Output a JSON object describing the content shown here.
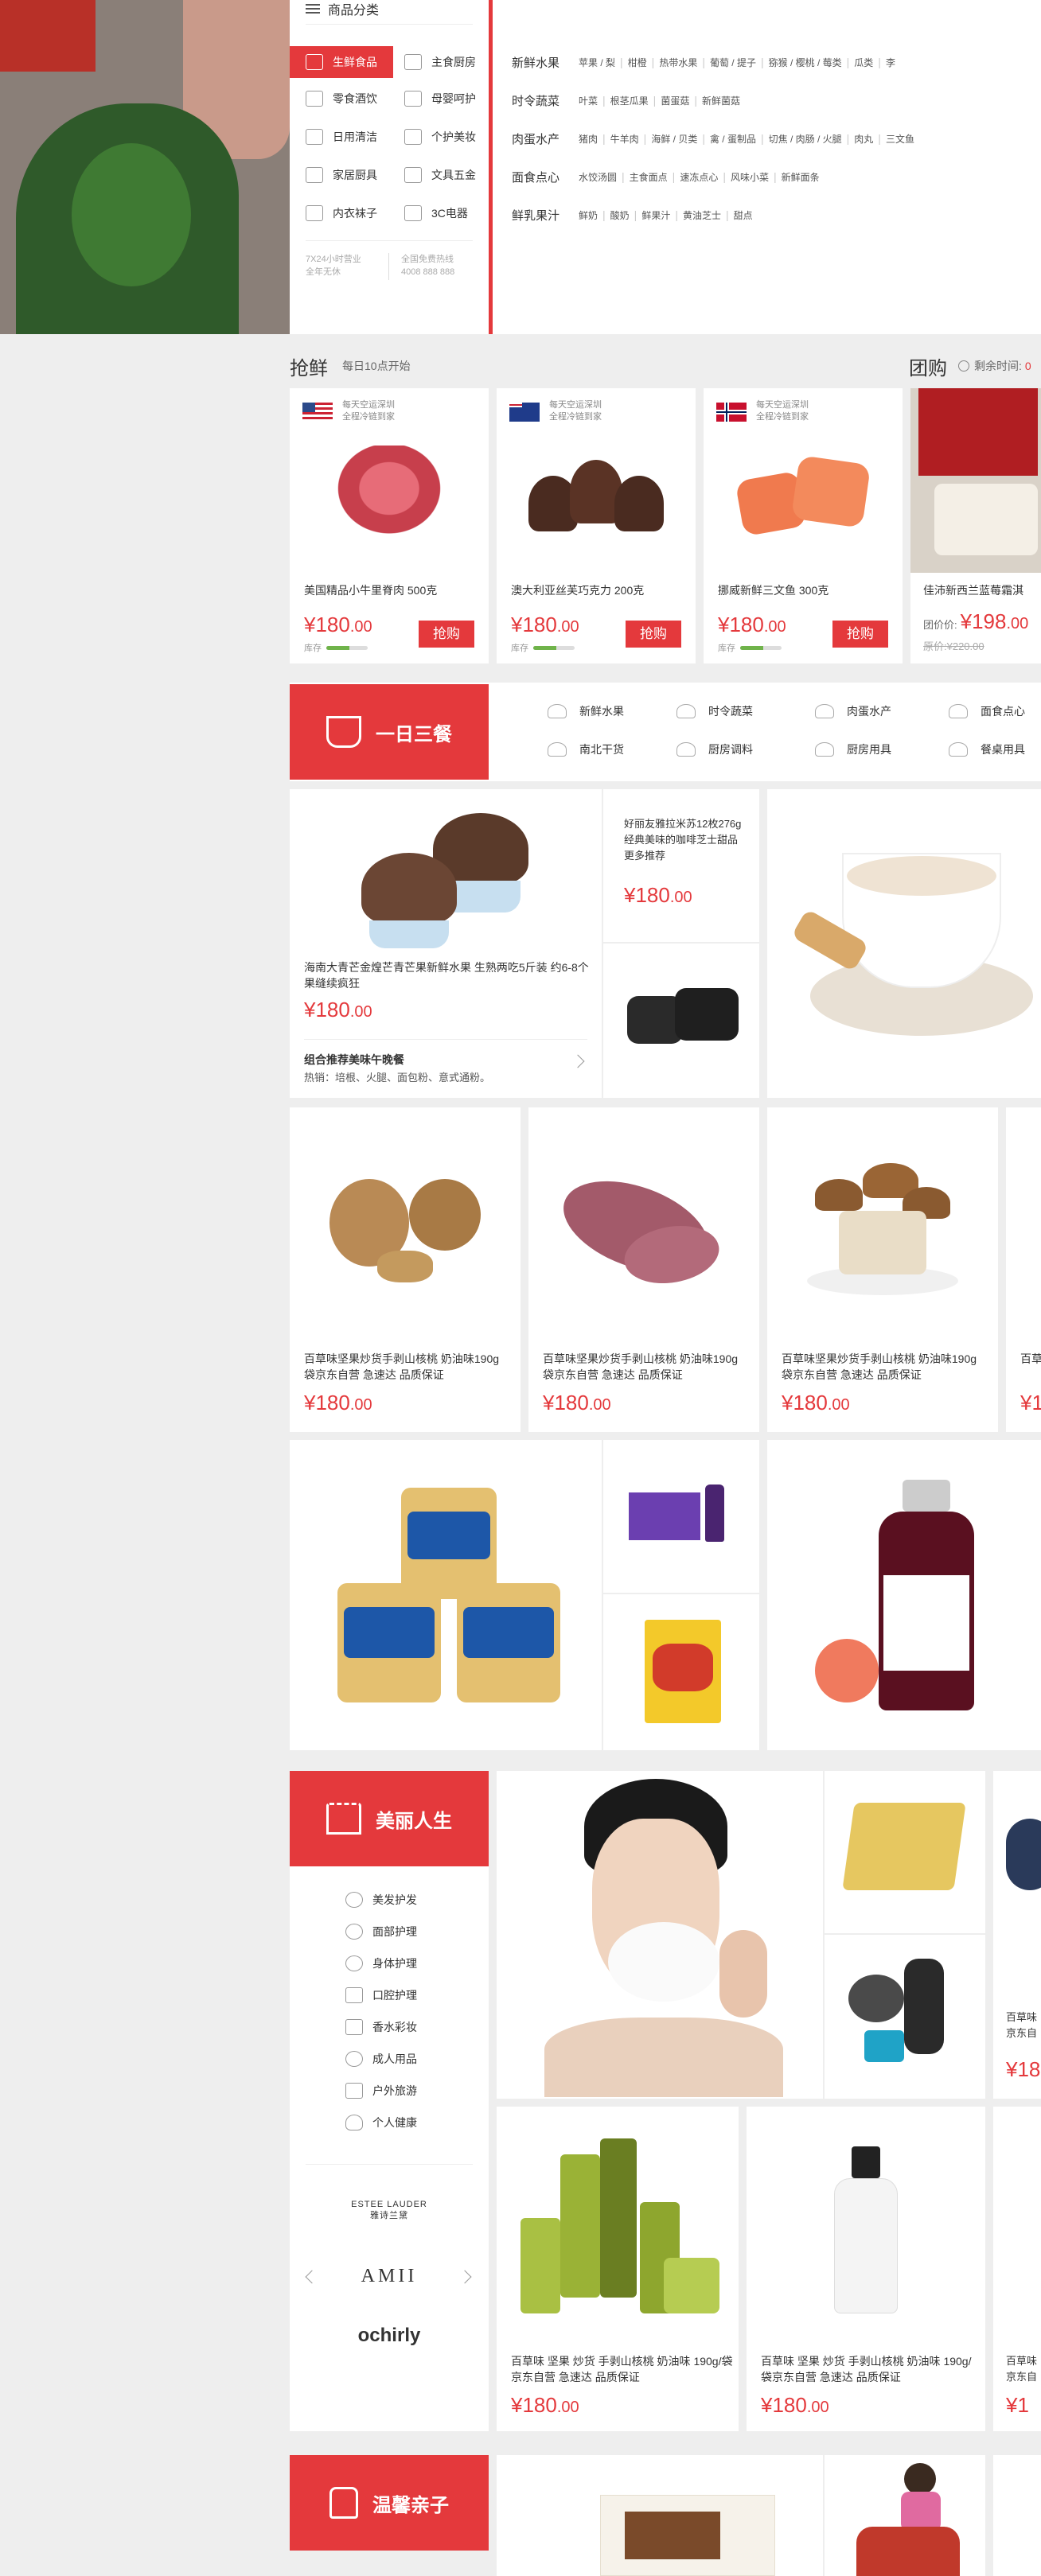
{
  "category_menu": {
    "title": "商品分类",
    "side_items": [
      {
        "label": "生鲜食品",
        "icon": "fish-icon",
        "active": true
      },
      {
        "label": "主食厨房",
        "icon": "bread-icon"
      },
      {
        "label": "零食酒饮",
        "icon": "drink-icon"
      },
      {
        "label": "母婴呵护",
        "icon": "baby-bottle-icon"
      },
      {
        "label": "日用清洁",
        "icon": "detergent-icon"
      },
      {
        "label": "个护美妆",
        "icon": "cosmetics-icon"
      },
      {
        "label": "家居厨具",
        "icon": "pot-icon"
      },
      {
        "label": "文具五金",
        "icon": "pencil-icon"
      },
      {
        "label": "内衣袜子",
        "icon": "shirt-icon"
      },
      {
        "label": "3C电器",
        "icon": "monitor-icon"
      }
    ],
    "service_left_1": "7X24小时营业",
    "service_left_2": "全年无休",
    "service_right_1": "全国免费热线",
    "service_right_2": "4008 888 888"
  },
  "category_detail": [
    {
      "head": "新鲜水果",
      "items": [
        "苹果 / 梨",
        "柑橙",
        "热带水果",
        "葡萄 / 提子",
        "猕猴 / 樱桃 / 莓类",
        "瓜类",
        "李"
      ],
      "highlight": 2
    },
    {
      "head": "时令蔬菜",
      "items": [
        "叶菜",
        "根茎瓜果",
        "菌蛋菇",
        "新鲜菌菇"
      ],
      "highlight": -1
    },
    {
      "head": "肉蛋水产",
      "items": [
        "猪肉",
        "牛羊肉",
        "海鲜 / 贝类",
        "禽 / 蛋制品",
        "切焦 / 肉肠 / 火腿",
        "肉丸",
        "三文鱼"
      ],
      "highlight": -1
    },
    {
      "head": "面食点心",
      "items": [
        "水饺汤圆",
        "主食面点",
        "速冻点心",
        "风味小菜",
        "新鲜面条"
      ],
      "highlight": -1
    },
    {
      "head": "鲜乳果汁",
      "items": [
        "鲜奶",
        "酸奶",
        "鲜果汁",
        "黄油芝士",
        "甜点"
      ],
      "highlight": -1
    }
  ],
  "flash_sale": {
    "title": "抢鲜",
    "subtitle": "每日10点开始",
    "ship_line1": "每天空运深圳",
    "ship_line2": "全程冷链到家",
    "stock_label": "库存",
    "buy_label": "抢购",
    "items": [
      {
        "name": "美国精品小牛里脊肉 500克",
        "price_int": "¥180",
        "price_dec": ".00",
        "flag": "usa-flag-icon",
        "stock": 0.55
      },
      {
        "name": "澳大利亚丝芙巧克力 200克",
        "price_int": "¥180",
        "price_dec": ".00",
        "flag": "australia-flag-icon",
        "stock": 0.55
      },
      {
        "name": "挪威新鲜三文鱼 300克",
        "price_int": "¥180",
        "price_dec": ".00",
        "flag": "norway-flag-icon",
        "stock": 0.55
      }
    ]
  },
  "group_buy": {
    "title": "团购",
    "countdown_label": "剩余时间:",
    "countdown_value": "0",
    "item_name": "佳沛新西兰蓝莓霜淇",
    "price_label": "团价价:",
    "price_int": "¥198",
    "price_dec": ".00",
    "original_price": "原价:¥220.00"
  },
  "meals_section": {
    "tag": "一日三餐",
    "sub_categories": [
      "新鲜水果",
      "时令蔬菜",
      "肉蛋水产",
      "面食点心",
      "南北干货",
      "厨房调料",
      "厨房用具",
      "餐桌用具"
    ],
    "feature": {
      "name": "海南大青芒金煌芒青芒果新鲜水果 生熟两吃5斤装 约6-8个果缝续疯狂",
      "price_int": "¥180",
      "price_dec": ".00",
      "combo_title": "组合推荐美味午晚餐",
      "combo_text": "热销：培根、火腿、面包粉、意式通粉。"
    },
    "side_item": {
      "name": "好丽友雅拉米苏12枚276g经典美味的咖啡芝士甜品更多推荐",
      "price_int": "¥180",
      "price_dec": ".00"
    },
    "products": [
      {
        "name": "百草味坚果炒货手剥山核桃 奶油味190g 袋京东自营 急速达 品质保证",
        "price_int": "¥180",
        "price_dec": ".00"
      },
      {
        "name": "百草味坚果炒货手剥山核桃 奶油味190g 袋京东自营 急速达 品质保证",
        "price_int": "¥180",
        "price_dec": ".00"
      },
      {
        "name": "百草味坚果炒货手剥山核桃 奶油味190g 袋京东自营 急速达 品质保证",
        "price_int": "¥180",
        "price_dec": ".00"
      },
      {
        "name": "百草",
        "price_int": "¥1",
        "price_dec": ""
      }
    ]
  },
  "beauty_section": {
    "tag": "美丽人生",
    "sub_categories": [
      "美发护发",
      "面部护理",
      "身体护理",
      "口腔护理",
      "香水彩妆",
      "成人用品",
      "户外旅游",
      "个人健康"
    ],
    "brands": [
      "ESTEE LAUDER 雅诗兰黛",
      "AMII",
      "ochirly"
    ],
    "products": [
      {
        "name": "百草味 坚果 炒货 手剥山核桃 奶油味 190g/袋京东自营 急速达 品质保证",
        "price_int": "¥180",
        "price_dec": ".00"
      },
      {
        "name": "百草味 坚果 炒货 手剥山核桃 奶油味 190g/袋京东自营 急速达 品质保证",
        "price_int": "¥180",
        "price_dec": ".00"
      },
      {
        "name": "百草味 京东自",
        "price_int": "¥1",
        "price_dec": ""
      }
    ],
    "side_product": {
      "name": "百草味 京东自",
      "price_int": "¥18",
      "price_dec": ""
    }
  },
  "family_section": {
    "tag": "温馨亲子"
  },
  "colors": {
    "accent": "#e4393c",
    "page_bg": "#eeeeee",
    "card_bg": "#ffffff"
  }
}
